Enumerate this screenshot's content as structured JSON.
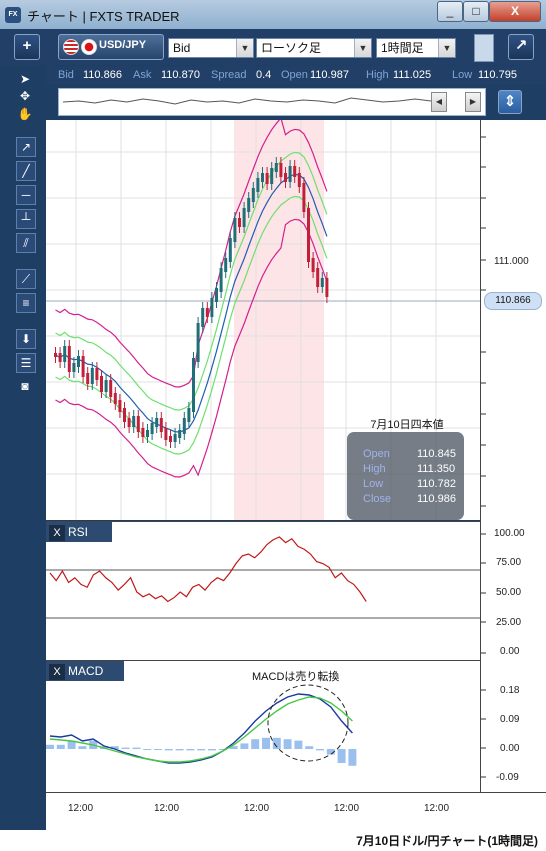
{
  "window": {
    "title": "チャート | FXTS TRADER",
    "app_icon": "FX",
    "buttons": {
      "minimize": "_",
      "maximize": "□",
      "close": "X"
    }
  },
  "toolbar": {
    "add_label": "+",
    "pair_label": "USD/JPY",
    "price_type": "Bid",
    "chart_style": "ローソク足",
    "timeframe": "1時間足",
    "detach_label": "↗"
  },
  "quote": {
    "bid_label": "Bid",
    "bid": "110.866",
    "ask_label": "Ask",
    "ask": "110.870",
    "spread_label": "Spread",
    "spread": "0.4",
    "open_label": "Open",
    "open": "110.987",
    "high_label": "High",
    "high": "111.025",
    "low_label": "Low",
    "low": "110.795"
  },
  "price_axis": {
    "labels": [
      "111.000"
    ],
    "current_price": "110.866"
  },
  "ohlc_box": {
    "title": "7月10日四本値",
    "rows": [
      {
        "label": "Open",
        "value": "110.845"
      },
      {
        "label": "High",
        "value": "111.350"
      },
      {
        "label": "Low",
        "value": "110.782"
      },
      {
        "label": "Close",
        "value": "110.986"
      }
    ]
  },
  "rsi": {
    "title": "RSI",
    "close_label": "X",
    "axis_labels": [
      "100.00",
      "75.00",
      "50.00",
      "25.00",
      "0.00"
    ]
  },
  "macd": {
    "title": "MACD",
    "close_label": "X",
    "axis_labels": [
      "0.18",
      "0.09",
      "0.00",
      "-0.09"
    ],
    "annotation": "MACDは売り転換"
  },
  "time_axis": {
    "labels": [
      "12:00",
      "12:00",
      "12:00",
      "12:00",
      "12:00"
    ]
  },
  "caption": "7月10日ドル/円チャート(1時間足)",
  "colors": {
    "candle_up": "#1f6e78",
    "candle_down": "#c0203a",
    "bollinger": "#d4208e",
    "ma_mid": "#1f5fb0",
    "ma_inner": "#6ee06e",
    "rsi_line": "#c01818",
    "macd_line": "#1b3a9e",
    "signal_line": "#44c844",
    "histogram": "#9cc0ee",
    "highlight": "#fde4e6"
  }
}
